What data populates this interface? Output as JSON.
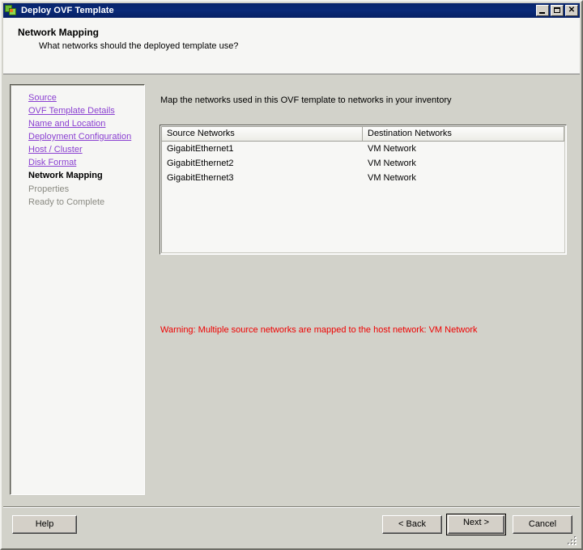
{
  "window": {
    "title": "Deploy OVF Template",
    "icon": "ovf-template-icon",
    "controls": {
      "minimize_label": "_",
      "maximize_label": "□",
      "close_label": "✕"
    }
  },
  "header": {
    "title": "Network Mapping",
    "subtitle": "What networks should the deployed template use?"
  },
  "sidebar": {
    "items": [
      {
        "label": "Source",
        "state": "link"
      },
      {
        "label": "OVF Template Details",
        "state": "link"
      },
      {
        "label": "Name and Location",
        "state": "link"
      },
      {
        "label": "Deployment Configuration",
        "state": "link"
      },
      {
        "label": "Host / Cluster",
        "state": "link"
      },
      {
        "label": "Disk Format",
        "state": "link"
      },
      {
        "label": "Network Mapping",
        "state": "current"
      },
      {
        "label": "Properties",
        "state": "disabled"
      },
      {
        "label": "Ready to Complete",
        "state": "disabled"
      }
    ]
  },
  "main": {
    "description": "Map the networks used in this OVF template to networks in your inventory",
    "table": {
      "columns": [
        "Source Networks",
        "Destination Networks"
      ],
      "rows": [
        [
          "GigabitEthernet1",
          "VM Network"
        ],
        [
          "GigabitEthernet2",
          "VM Network"
        ],
        [
          "GigabitEthernet3",
          "VM Network"
        ]
      ]
    },
    "warning": "Warning: Multiple source networks are mapped to the host network: VM Network",
    "warning_color": "#ee0000"
  },
  "footer": {
    "help_label": "Help",
    "back_label": "< Back",
    "next_label": "Next >",
    "cancel_label": "Cancel"
  },
  "colors": {
    "titlebar": "#0a246a",
    "body_background": "#d2d2ca",
    "header_background": "#f6f6f4",
    "link": "#8a3fd1",
    "warning": "#ee0000"
  }
}
